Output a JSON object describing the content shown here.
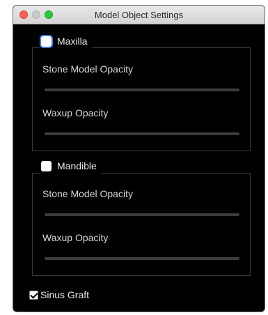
{
  "window": {
    "title": "Model Object Settings"
  },
  "maxilla": {
    "label": "Maxilla",
    "checked": false,
    "stone_label": "Stone Model Opacity",
    "waxup_label": "Waxup Opacity"
  },
  "mandible": {
    "label": "Mandible",
    "checked": false,
    "stone_label": "Stone Model Opacity",
    "waxup_label": "Waxup Opacity"
  },
  "sinus": {
    "label": "Sinus Graft",
    "checked": true
  },
  "colors": {
    "background": "#000000",
    "accent_focus": "#3b78e7"
  }
}
